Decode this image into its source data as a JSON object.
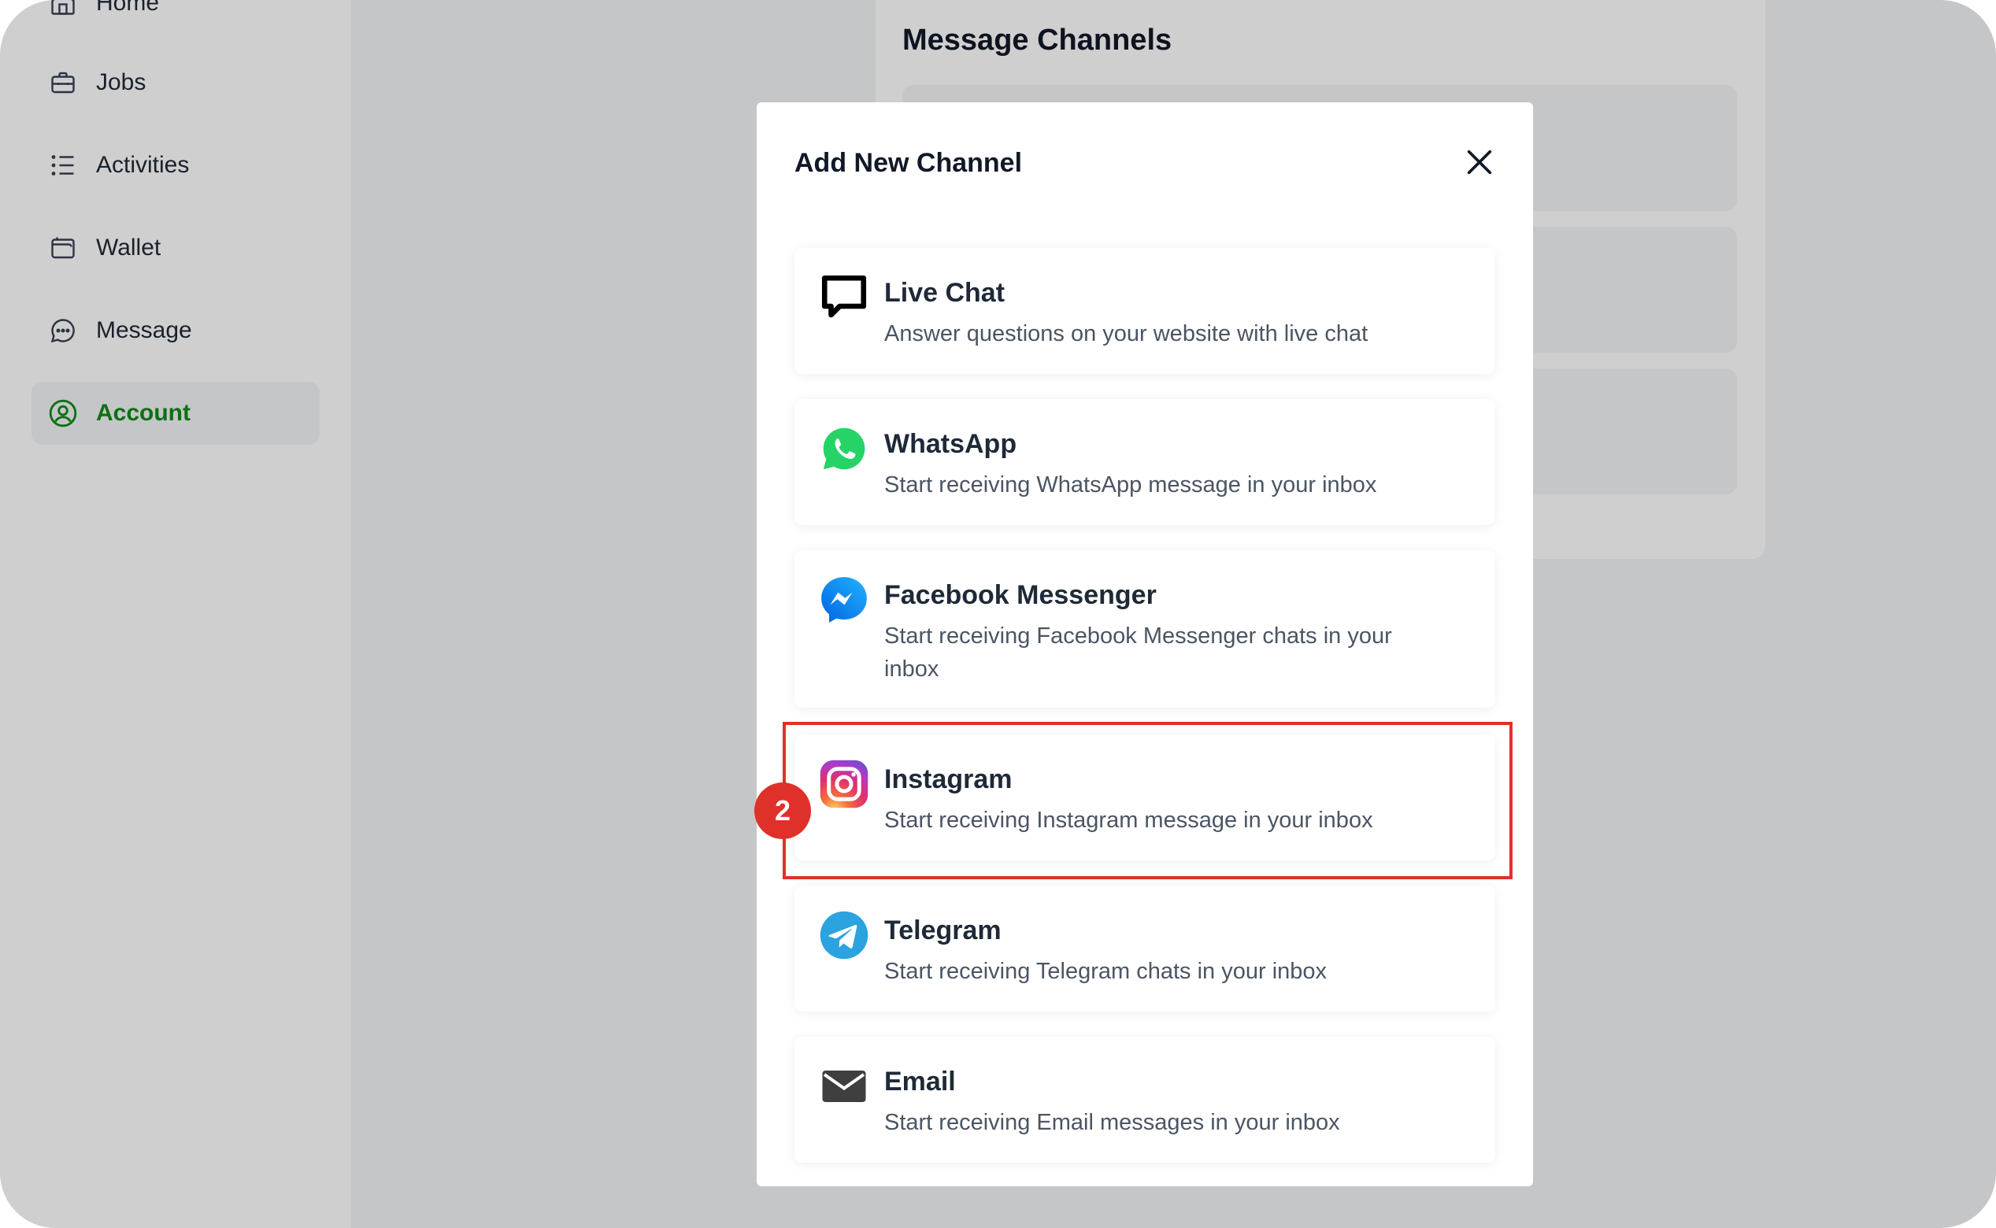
{
  "sidebar": {
    "items": [
      {
        "label": "Home",
        "icon": "home-icon"
      },
      {
        "label": "Jobs",
        "icon": "briefcase-icon"
      },
      {
        "label": "Activities",
        "icon": "list-icon"
      },
      {
        "label": "Wallet",
        "icon": "wallet-icon"
      },
      {
        "label": "Message",
        "icon": "chat-bubble-icon"
      },
      {
        "label": "Account",
        "icon": "user-circle-icon",
        "active": true
      }
    ]
  },
  "background_page": {
    "title": "Message Channels"
  },
  "modal": {
    "title": "Add New Channel",
    "close_icon": "close-icon",
    "channels": [
      {
        "name": "Live Chat",
        "description": "Answer questions on your website with live chat",
        "icon": "live-chat-icon"
      },
      {
        "name": "WhatsApp",
        "description": "Start receiving WhatsApp message in your inbox",
        "icon": "whatsapp-icon"
      },
      {
        "name": "Facebook Messenger",
        "description": "Start receiving Facebook Messenger chats in your inbox",
        "icon": "messenger-icon"
      },
      {
        "name": "Instagram",
        "description": "Start receiving Instagram message in your inbox",
        "icon": "instagram-icon"
      },
      {
        "name": "Telegram",
        "description": "Start receiving Telegram chats in your inbox",
        "icon": "telegram-icon"
      },
      {
        "name": "Email",
        "description": "Start receiving Email messages in your inbox",
        "icon": "email-icon"
      }
    ]
  },
  "annotation": {
    "step_number": "2",
    "color": "#e0302a"
  },
  "colors": {
    "accent": "#0e8a16",
    "whatsapp": "#25d366",
    "messenger": "#0a7cff",
    "telegram": "#2aa3e0"
  }
}
